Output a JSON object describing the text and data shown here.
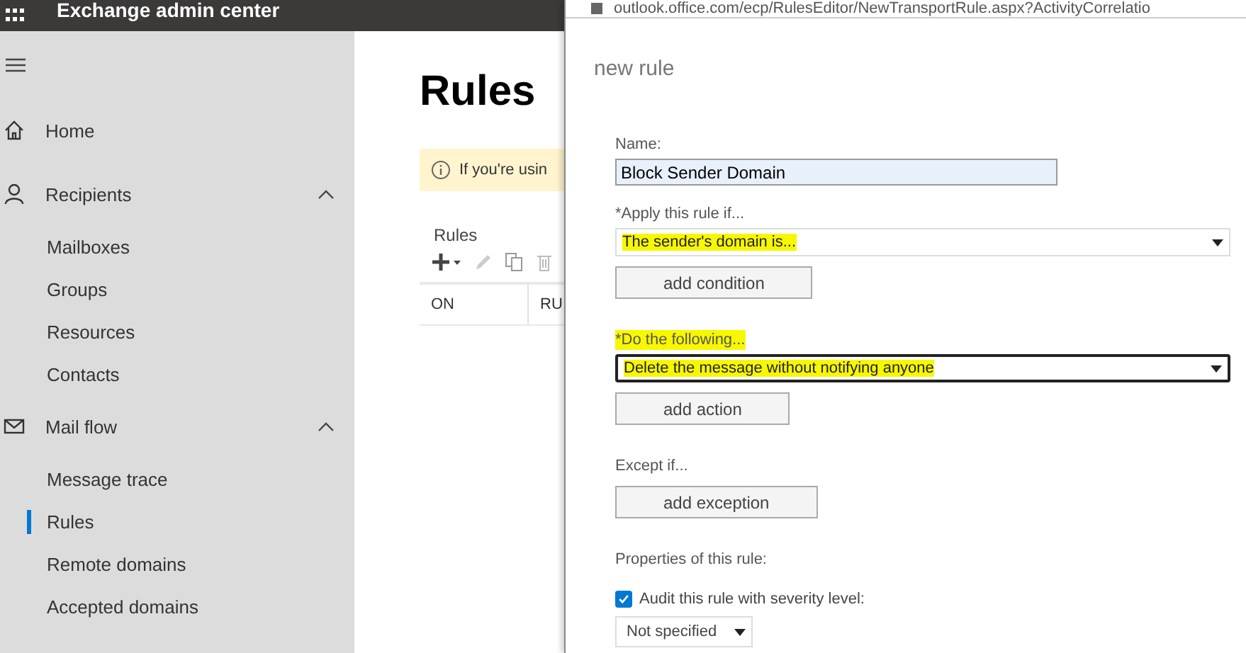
{
  "top_bar": {
    "title": "Exchange admin center"
  },
  "nav": [
    {
      "kind": "home",
      "label": "Home"
    },
    {
      "kind": "person",
      "label": "Recipients",
      "expanded": true,
      "children": [
        {
          "label": "Mailboxes",
          "selected": false
        },
        {
          "label": "Groups",
          "selected": false
        },
        {
          "label": "Resources",
          "selected": false
        },
        {
          "label": "Contacts",
          "selected": false
        }
      ]
    },
    {
      "kind": "mail",
      "label": "Mail flow",
      "expanded": true,
      "children": [
        {
          "label": "Message trace",
          "selected": false
        },
        {
          "label": "Rules",
          "selected": true
        },
        {
          "label": "Remote domains",
          "selected": false
        },
        {
          "label": "Accepted domains",
          "selected": false
        }
      ]
    }
  ],
  "main": {
    "heading": "Rules",
    "notice": "If you're usin",
    "section": "Rules",
    "columns": [
      "ON",
      "RU"
    ]
  },
  "popup": {
    "url": "outlook.office.com/ecp/RulesEditor/NewTransportRule.aspx?ActivityCorrelatio",
    "title": "new rule",
    "name_label": "Name:",
    "name_value": "Block Sender Domain",
    "groups": [
      {
        "label": "*Apply this rule if...",
        "label_highlighted": false,
        "select": "The sender's domain is...",
        "select_highlighted": true,
        "focused": false,
        "button": "add condition"
      },
      {
        "label": "*Do the following...",
        "label_highlighted": true,
        "select": "Delete the message without notifying anyone",
        "select_highlighted": true,
        "focused": true,
        "button": "add action"
      },
      {
        "label": "Except if...",
        "label_highlighted": false,
        "button": "add exception"
      }
    ],
    "properties_label": "Properties of this rule:",
    "audit": {
      "label": "Audit this rule with severity level:",
      "checked": true
    },
    "severity": "Not specified"
  }
}
